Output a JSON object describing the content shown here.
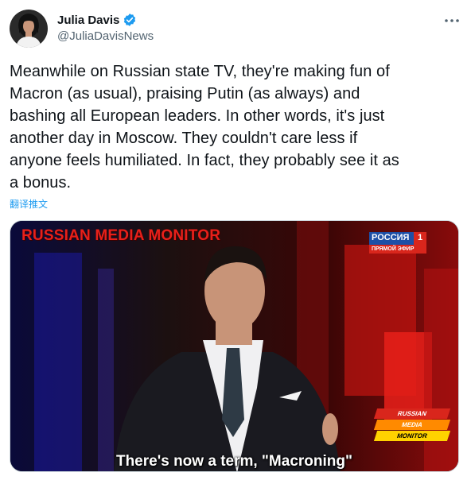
{
  "author": {
    "display_name": "Julia Davis",
    "handle": "@JuliaDavisNews",
    "verified": true,
    "avatar_icon": "profile-photo"
  },
  "tweet": {
    "text": "Meanwhile on Russian state TV, they're making fun of\nMacron (as usual), praising Putin (as always) and\nbashing all European leaders. In other words, it's just\nanother day in Moscow. They couldn't care less if\nanyone feels humiliated. In fact, they probably see it as\na bonus.",
    "translate_label": "翻译推文"
  },
  "media": {
    "banner": "RUSSIAN MEDIA MONITOR",
    "channel_name": "РОССИЯ",
    "channel_number": "1",
    "channel_live": "ПРЯМОЙ ЭФИР",
    "logo_lines": [
      "RUSSIAN",
      "MEDIA",
      "MONITOR"
    ],
    "subtitle": "There's now a term, \"Macroning\""
  },
  "colors": {
    "accent": "#1d9bf0",
    "text": "#0f1419",
    "secondary": "#536471",
    "banner_red": "#e8201a"
  }
}
